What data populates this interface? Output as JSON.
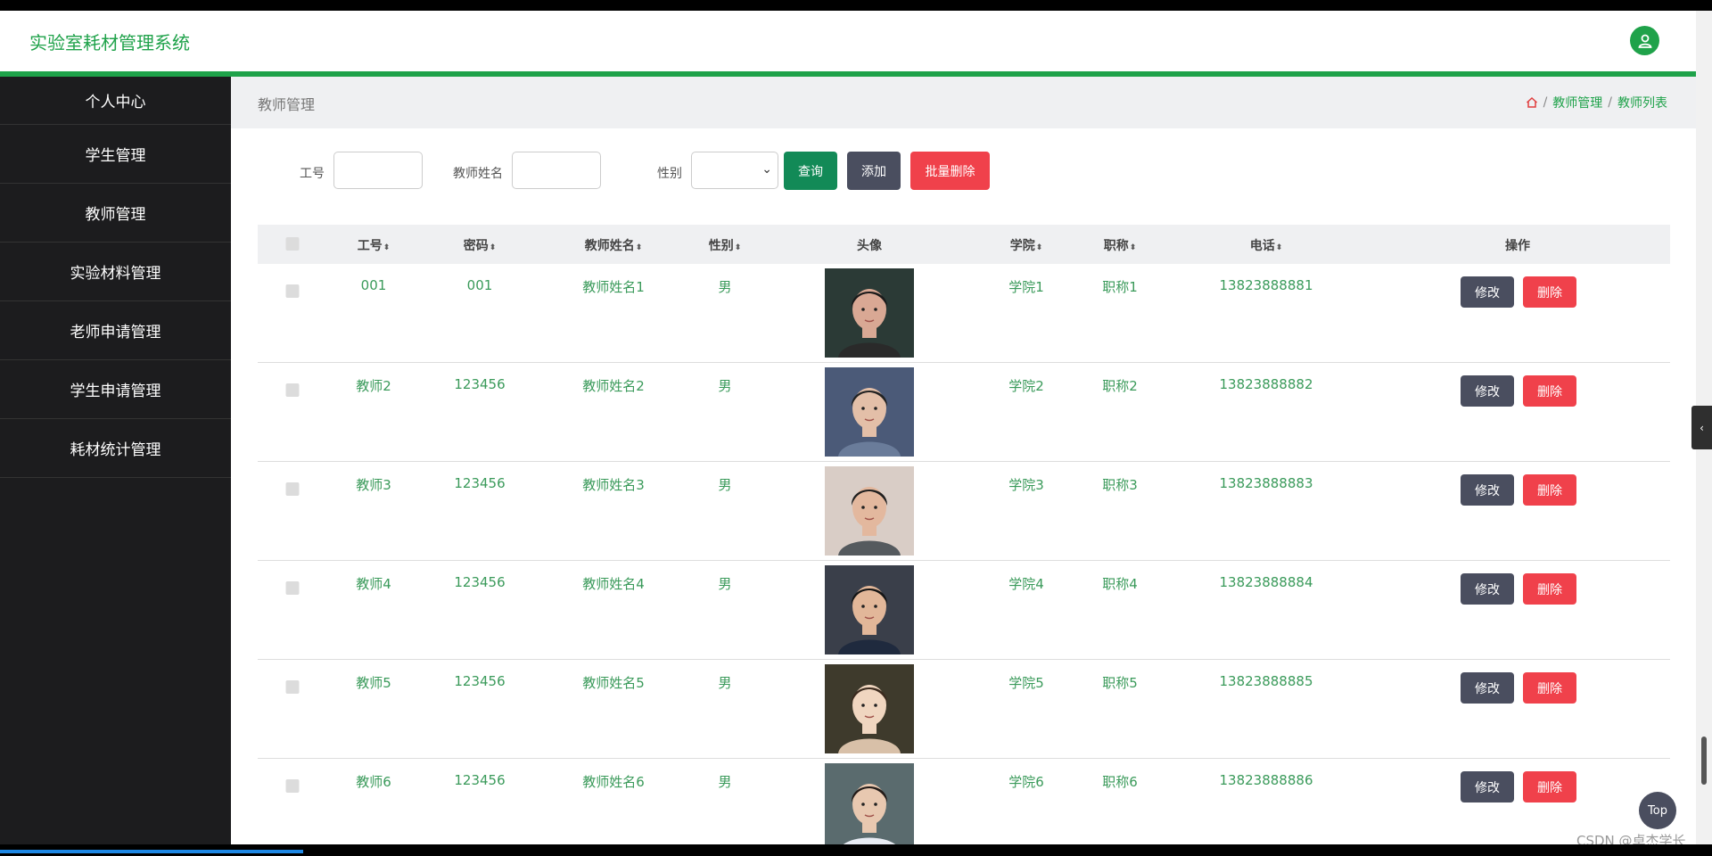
{
  "app": {
    "title": "实验室耗材管理系统"
  },
  "sidebar": {
    "items": [
      {
        "label": "个人中心"
      },
      {
        "label": "学生管理"
      },
      {
        "label": "教师管理"
      },
      {
        "label": "实验材料管理"
      },
      {
        "label": "老师申请管理"
      },
      {
        "label": "学生申请管理"
      },
      {
        "label": "耗材统计管理"
      }
    ]
  },
  "page": {
    "title": "教师管理",
    "breadcrumb": [
      "教师管理",
      "教师列表"
    ],
    "breadcrumb_sep": "/"
  },
  "filters": {
    "job_no_label": "工号",
    "name_label": "教师姓名",
    "gender_label": "性别",
    "query_label": "查询",
    "add_label": "添加",
    "batch_delete_label": "批量删除"
  },
  "table": {
    "columns": [
      "工号",
      "密码",
      "教师姓名",
      "性别",
      "头像",
      "学院",
      "职称",
      "电话",
      "操作"
    ],
    "sort_glyph": "⬍",
    "edit_label": "修改",
    "delete_label": "删除",
    "rows": [
      {
        "job_no": "001",
        "password": "001",
        "name": "教师姓名1",
        "gender": "男",
        "college": "学院1",
        "title": "职称1",
        "phone": "13823888881",
        "avatar": "female-portrait-1"
      },
      {
        "job_no": "教师2",
        "password": "123456",
        "name": "教师姓名2",
        "gender": "男",
        "college": "学院2",
        "title": "职称2",
        "phone": "13823888882",
        "avatar": "male-portrait-glasses"
      },
      {
        "job_no": "教师3",
        "password": "123456",
        "name": "教师姓名3",
        "gender": "男",
        "college": "学院3",
        "title": "职称3",
        "phone": "13823888883",
        "avatar": "male-portrait-tshirt"
      },
      {
        "job_no": "教师4",
        "password": "123456",
        "name": "教师姓名4",
        "gender": "男",
        "college": "学院4",
        "title": "职称4",
        "phone": "13823888884",
        "avatar": "male-portrait-suit"
      },
      {
        "job_no": "教师5",
        "password": "123456",
        "name": "教师姓名5",
        "gender": "男",
        "college": "学院5",
        "title": "职称5",
        "phone": "13823888885",
        "avatar": "female-portrait-2"
      },
      {
        "job_no": "教师6",
        "password": "123456",
        "name": "教师姓名6",
        "gender": "男",
        "college": "学院6",
        "title": "职称6",
        "phone": "13823888886",
        "avatar": "female-portrait-3"
      }
    ]
  },
  "widgets": {
    "top_label": "Top",
    "watermark": "CSDN @卓杰学长"
  },
  "colors": {
    "accent": "#1fa24a",
    "sidebar_bg": "#1c1c1e",
    "danger": "#f0414b",
    "dark_button": "#4a4e5f",
    "query": "#128a57"
  }
}
